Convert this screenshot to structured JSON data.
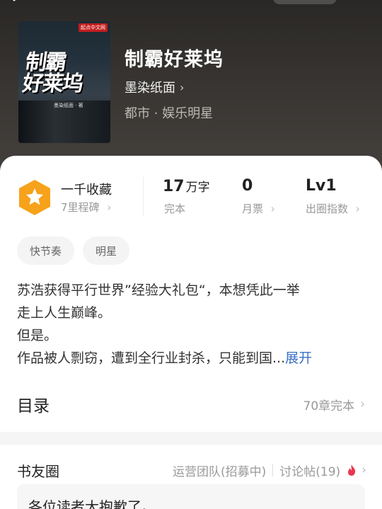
{
  "book": {
    "title": "制霸好莱坞",
    "author": "墨染纸面",
    "genre": "都市 · 娱乐明星",
    "cover": {
      "title_line1": "制霸",
      "title_line2": "好莱坞",
      "author": "墨染纸面 · 著",
      "badge": "起点中文网"
    }
  },
  "stats": {
    "favorites_title": "一千收藏",
    "favorites_sub": "7里程碑",
    "words_num": "17",
    "words_unit": "万字",
    "words_label": "完本",
    "votes_num": "0",
    "votes_label": "月票",
    "level_num": "Lv1",
    "level_label": "出圈指数"
  },
  "tags": [
    "快节奏",
    "明星"
  ],
  "synopsis": {
    "line1": "苏浩获得平行世界”经验大礼包“，本想凭此一举",
    "line2": "走上人生巅峰。",
    "line3": "但是。",
    "line4": "作品被人剽窃，遭到全行业封杀，只能到国...",
    "expand": "展开"
  },
  "toc": {
    "title": "目录",
    "info": "70章完本"
  },
  "circle": {
    "title": "书友圈",
    "ops": "运营团队(招募中)",
    "discussions": "讨论帖(19)"
  },
  "post": {
    "text": "各位读者大抱歉了。"
  },
  "colors": {
    "accent_link": "#3a6fc4",
    "badge_orange": "#f7a21b",
    "fire": "#e8384f"
  }
}
